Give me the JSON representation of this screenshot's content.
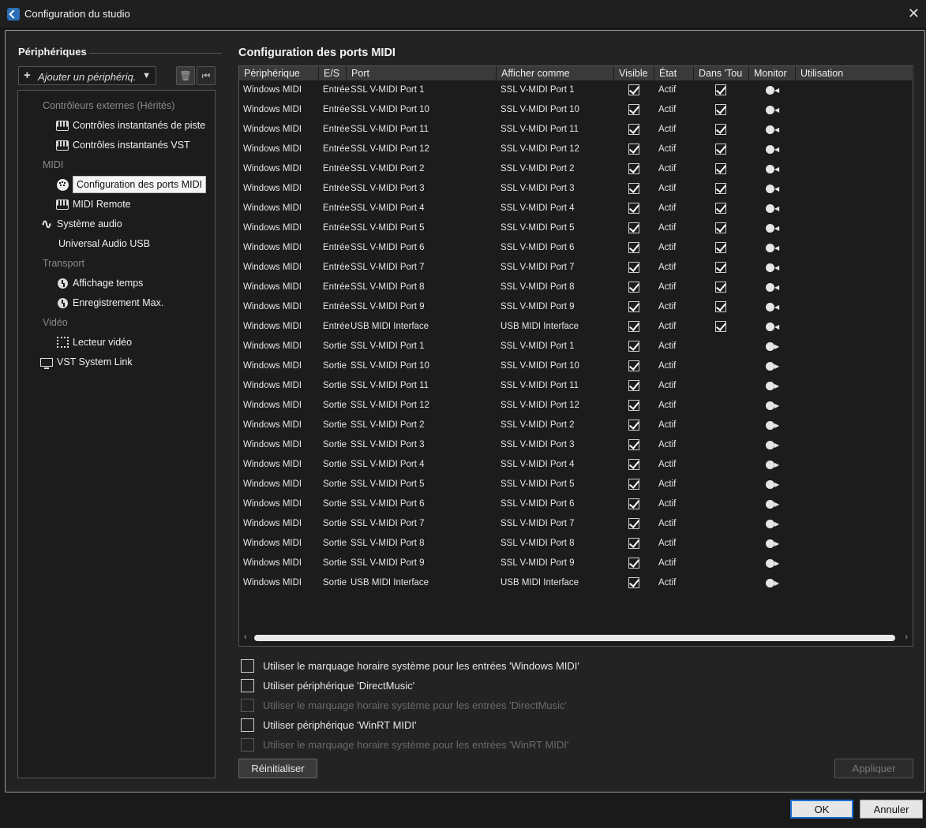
{
  "window": {
    "title": "Configuration du studio"
  },
  "left": {
    "title": "Périphériques",
    "add_placeholder": "Ajouter un périphériq.",
    "tree": [
      {
        "label": "Contrôleurs externes (Hérités)",
        "kind": "category",
        "icon": ""
      },
      {
        "label": "Contrôles instantanés de piste",
        "kind": "item",
        "icon": "keyboard-icon"
      },
      {
        "label": "Contrôles instantanés VST",
        "kind": "item",
        "icon": "keyboard-icon"
      },
      {
        "label": "MIDI",
        "kind": "category",
        "icon": ""
      },
      {
        "label": "Configuration des ports MIDI",
        "kind": "item",
        "icon": "midi-port-icon",
        "selected": true
      },
      {
        "label": "MIDI Remote",
        "kind": "item",
        "icon": "keyboard-icon"
      },
      {
        "label": "Système audio",
        "kind": "item",
        "icon": "waveform-icon"
      },
      {
        "label": "Universal Audio USB",
        "kind": "item",
        "icon": ""
      },
      {
        "label": "Transport",
        "kind": "category",
        "icon": ""
      },
      {
        "label": "Affichage temps",
        "kind": "item",
        "icon": "clock-icon"
      },
      {
        "label": "Enregistrement Max.",
        "kind": "item",
        "icon": "clock-icon"
      },
      {
        "label": "Vidéo",
        "kind": "category",
        "icon": ""
      },
      {
        "label": "Lecteur vidéo",
        "kind": "item",
        "icon": "film-icon"
      },
      {
        "label": "VST System Link",
        "kind": "item",
        "icon": "monitor-icon"
      }
    ]
  },
  "right": {
    "title": "Configuration des ports MIDI",
    "columns": [
      "Périphérique",
      "E/S",
      "Port",
      "Afficher comme",
      "Visible",
      "État",
      "Dans 'Tou",
      "Monitor",
      "Utilisation"
    ],
    "rows": [
      {
        "device": "Windows MIDI",
        "io": "Entrée",
        "port": "SSL V-MIDI Port 1",
        "display": "SSL V-MIDI Port 1",
        "visible": true,
        "state": "Actif",
        "in_all": true,
        "direction": "in"
      },
      {
        "device": "Windows MIDI",
        "io": "Entrée",
        "port": "SSL V-MIDI Port 10",
        "display": "SSL V-MIDI Port 10",
        "visible": true,
        "state": "Actif",
        "in_all": true,
        "direction": "in"
      },
      {
        "device": "Windows MIDI",
        "io": "Entrée",
        "port": "SSL V-MIDI Port 11",
        "display": "SSL V-MIDI Port 11",
        "visible": true,
        "state": "Actif",
        "in_all": true,
        "direction": "in"
      },
      {
        "device": "Windows MIDI",
        "io": "Entrée",
        "port": "SSL V-MIDI Port 12",
        "display": "SSL V-MIDI Port 12",
        "visible": true,
        "state": "Actif",
        "in_all": true,
        "direction": "in"
      },
      {
        "device": "Windows MIDI",
        "io": "Entrée",
        "port": "SSL V-MIDI Port 2",
        "display": "SSL V-MIDI Port 2",
        "visible": true,
        "state": "Actif",
        "in_all": true,
        "direction": "in"
      },
      {
        "device": "Windows MIDI",
        "io": "Entrée",
        "port": "SSL V-MIDI Port 3",
        "display": "SSL V-MIDI Port 3",
        "visible": true,
        "state": "Actif",
        "in_all": true,
        "direction": "in"
      },
      {
        "device": "Windows MIDI",
        "io": "Entrée",
        "port": "SSL V-MIDI Port 4",
        "display": "SSL V-MIDI Port 4",
        "visible": true,
        "state": "Actif",
        "in_all": true,
        "direction": "in"
      },
      {
        "device": "Windows MIDI",
        "io": "Entrée",
        "port": "SSL V-MIDI Port 5",
        "display": "SSL V-MIDI Port 5",
        "visible": true,
        "state": "Actif",
        "in_all": true,
        "direction": "in"
      },
      {
        "device": "Windows MIDI",
        "io": "Entrée",
        "port": "SSL V-MIDI Port 6",
        "display": "SSL V-MIDI Port 6",
        "visible": true,
        "state": "Actif",
        "in_all": true,
        "direction": "in"
      },
      {
        "device": "Windows MIDI",
        "io": "Entrée",
        "port": "SSL V-MIDI Port 7",
        "display": "SSL V-MIDI Port 7",
        "visible": true,
        "state": "Actif",
        "in_all": true,
        "direction": "in"
      },
      {
        "device": "Windows MIDI",
        "io": "Entrée",
        "port": "SSL V-MIDI Port 8",
        "display": "SSL V-MIDI Port 8",
        "visible": true,
        "state": "Actif",
        "in_all": true,
        "direction": "in"
      },
      {
        "device": "Windows MIDI",
        "io": "Entrée",
        "port": "SSL V-MIDI Port 9",
        "display": "SSL V-MIDI Port 9",
        "visible": true,
        "state": "Actif",
        "in_all": true,
        "direction": "in"
      },
      {
        "device": "Windows MIDI",
        "io": "Entrée",
        "port": "USB MIDI Interface",
        "display": "USB MIDI Interface",
        "visible": true,
        "state": "Actif",
        "in_all": true,
        "direction": "in"
      },
      {
        "device": "Windows MIDI",
        "io": "Sortie",
        "port": "SSL V-MIDI Port 1",
        "display": "SSL V-MIDI Port 1",
        "visible": true,
        "state": "Actif",
        "in_all": false,
        "direction": "out"
      },
      {
        "device": "Windows MIDI",
        "io": "Sortie",
        "port": "SSL V-MIDI Port 10",
        "display": "SSL V-MIDI Port 10",
        "visible": true,
        "state": "Actif",
        "in_all": false,
        "direction": "out"
      },
      {
        "device": "Windows MIDI",
        "io": "Sortie",
        "port": "SSL V-MIDI Port 11",
        "display": "SSL V-MIDI Port 11",
        "visible": true,
        "state": "Actif",
        "in_all": false,
        "direction": "out"
      },
      {
        "device": "Windows MIDI",
        "io": "Sortie",
        "port": "SSL V-MIDI Port 12",
        "display": "SSL V-MIDI Port 12",
        "visible": true,
        "state": "Actif",
        "in_all": false,
        "direction": "out"
      },
      {
        "device": "Windows MIDI",
        "io": "Sortie",
        "port": "SSL V-MIDI Port 2",
        "display": "SSL V-MIDI Port 2",
        "visible": true,
        "state": "Actif",
        "in_all": false,
        "direction": "out"
      },
      {
        "device": "Windows MIDI",
        "io": "Sortie",
        "port": "SSL V-MIDI Port 3",
        "display": "SSL V-MIDI Port 3",
        "visible": true,
        "state": "Actif",
        "in_all": false,
        "direction": "out"
      },
      {
        "device": "Windows MIDI",
        "io": "Sortie",
        "port": "SSL V-MIDI Port 4",
        "display": "SSL V-MIDI Port 4",
        "visible": true,
        "state": "Actif",
        "in_all": false,
        "direction": "out"
      },
      {
        "device": "Windows MIDI",
        "io": "Sortie",
        "port": "SSL V-MIDI Port 5",
        "display": "SSL V-MIDI Port 5",
        "visible": true,
        "state": "Actif",
        "in_all": false,
        "direction": "out"
      },
      {
        "device": "Windows MIDI",
        "io": "Sortie",
        "port": "SSL V-MIDI Port 6",
        "display": "SSL V-MIDI Port 6",
        "visible": true,
        "state": "Actif",
        "in_all": false,
        "direction": "out"
      },
      {
        "device": "Windows MIDI",
        "io": "Sortie",
        "port": "SSL V-MIDI Port 7",
        "display": "SSL V-MIDI Port 7",
        "visible": true,
        "state": "Actif",
        "in_all": false,
        "direction": "out"
      },
      {
        "device": "Windows MIDI",
        "io": "Sortie",
        "port": "SSL V-MIDI Port 8",
        "display": "SSL V-MIDI Port 8",
        "visible": true,
        "state": "Actif",
        "in_all": false,
        "direction": "out"
      },
      {
        "device": "Windows MIDI",
        "io": "Sortie",
        "port": "SSL V-MIDI Port 9",
        "display": "SSL V-MIDI Port 9",
        "visible": true,
        "state": "Actif",
        "in_all": false,
        "direction": "out"
      },
      {
        "device": "Windows MIDI",
        "io": "Sortie",
        "port": "USB MIDI Interface",
        "display": "USB MIDI Interface",
        "visible": true,
        "state": "Actif",
        "in_all": false,
        "direction": "out"
      }
    ],
    "options": [
      {
        "label": "Utiliser le marquage horaire système pour les entrées 'Windows MIDI'",
        "checked": false,
        "enabled": true
      },
      {
        "label": "Utiliser périphérique 'DirectMusic'",
        "checked": false,
        "enabled": true
      },
      {
        "label": "Utiliser le marquage horaire système pour les entrées 'DirectMusic'",
        "checked": false,
        "enabled": false
      },
      {
        "label": "Utiliser périphérique 'WinRT MIDI'",
        "checked": false,
        "enabled": true
      },
      {
        "label": "Utiliser le marquage horaire système pour les entrées 'WinRT MIDI'",
        "checked": false,
        "enabled": false
      }
    ],
    "reset_label": "Réinitialiser",
    "apply_label": "Appliquer"
  },
  "footer": {
    "ok_label": "OK",
    "cancel_label": "Annuler"
  },
  "colors": {
    "accent": "#1e6fd0",
    "background": "#232323",
    "panel": "#1c1c1c"
  }
}
